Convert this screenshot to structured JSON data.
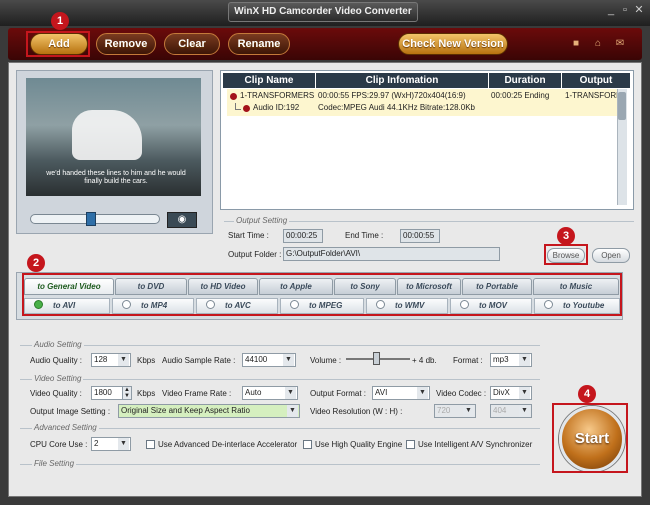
{
  "window": {
    "title": "WinX HD Camcorder Video Converter",
    "controls": [
      "_",
      "▫",
      "✕"
    ]
  },
  "toolbar": {
    "add_label": "Add",
    "remove_label": "Remove",
    "clear_label": "Clear",
    "rename_label": "Rename",
    "check_version_label": "Check New Version",
    "icons": [
      "lock-icon",
      "home-icon",
      "mail-icon"
    ]
  },
  "preview": {
    "subtitle": "we'd handed these lines to him and he would finally build the cars."
  },
  "clips": {
    "columns": [
      "Clip Name",
      "Clip Infomation",
      "Duration",
      "Output"
    ],
    "rows": [
      {
        "name": "1-TRANSFORMERS2",
        "info": "00:00:55  FPS:29.97 (WxH)720x404(16:9)",
        "duration": "00:00:25  Ending",
        "output": "1-TRANSFORM"
      },
      {
        "name": "Audio ID:192",
        "info": "Codec:MPEG Audi  44.1KHz   Bitrate:128.0Kb",
        "duration": "",
        "output": ""
      }
    ]
  },
  "output_setting": {
    "legend": "Output Setting",
    "start_label": "Start Time :",
    "start_value": "00:00:25",
    "end_label": "End Time :",
    "end_value": "00:00:55",
    "folder_label": "Output Folder :",
    "folder_value": "G:\\OutputFolder\\AVI\\",
    "browse_label": "Browse",
    "open_label": "Open"
  },
  "format_tabs": {
    "categories": [
      "to General Video",
      "to DVD",
      "to HD Video",
      "to Apple",
      "to Sony",
      "to Microsoft",
      "to Portable",
      "to Music"
    ],
    "formats": [
      "to AVI",
      "to MP4",
      "to AVC",
      "to MPEG",
      "to WMV",
      "to MOV",
      "to Youtube"
    ]
  },
  "audio_setting": {
    "legend": "Audio Setting",
    "quality_label": "Audio Quality :",
    "quality_value": "128",
    "kbps": "Kbps",
    "sample_label": "Audio Sample Rate :",
    "sample_value": "44100",
    "volume_label": "Volume :",
    "volume_value": "+ 4 db.",
    "format_label": "Format :",
    "format_value": "mp3"
  },
  "video_setting": {
    "legend": "Video Setting",
    "quality_label": "Video Quality :",
    "quality_value": "1800",
    "kbps": "Kbps",
    "frame_label": "Video Frame Rate :",
    "frame_value": "Auto",
    "out_format_label": "Output Format :",
    "out_format_value": "AVI",
    "codec_label": "Video Codec :",
    "codec_value": "DivX",
    "image_label": "Output Image Setting :",
    "image_value": "Original Size and Keep Aspect Ratio",
    "res_label": "Video Resolution (W : H) :",
    "res_w": "720",
    "res_h": "404"
  },
  "advanced_setting": {
    "legend": "Advanced Setting",
    "cpu_label": "CPU Core Use :",
    "cpu_value": "2",
    "deinterlace_label": "Use Advanced De-interlace Accelerator",
    "hq_label": "Use High Quality Engine",
    "sync_label": "Use Intelligent A/V Synchronizer"
  },
  "file_setting": {
    "legend": "File Setting"
  },
  "start_label": "Start",
  "callouts": [
    "1",
    "2",
    "3",
    "4"
  ]
}
